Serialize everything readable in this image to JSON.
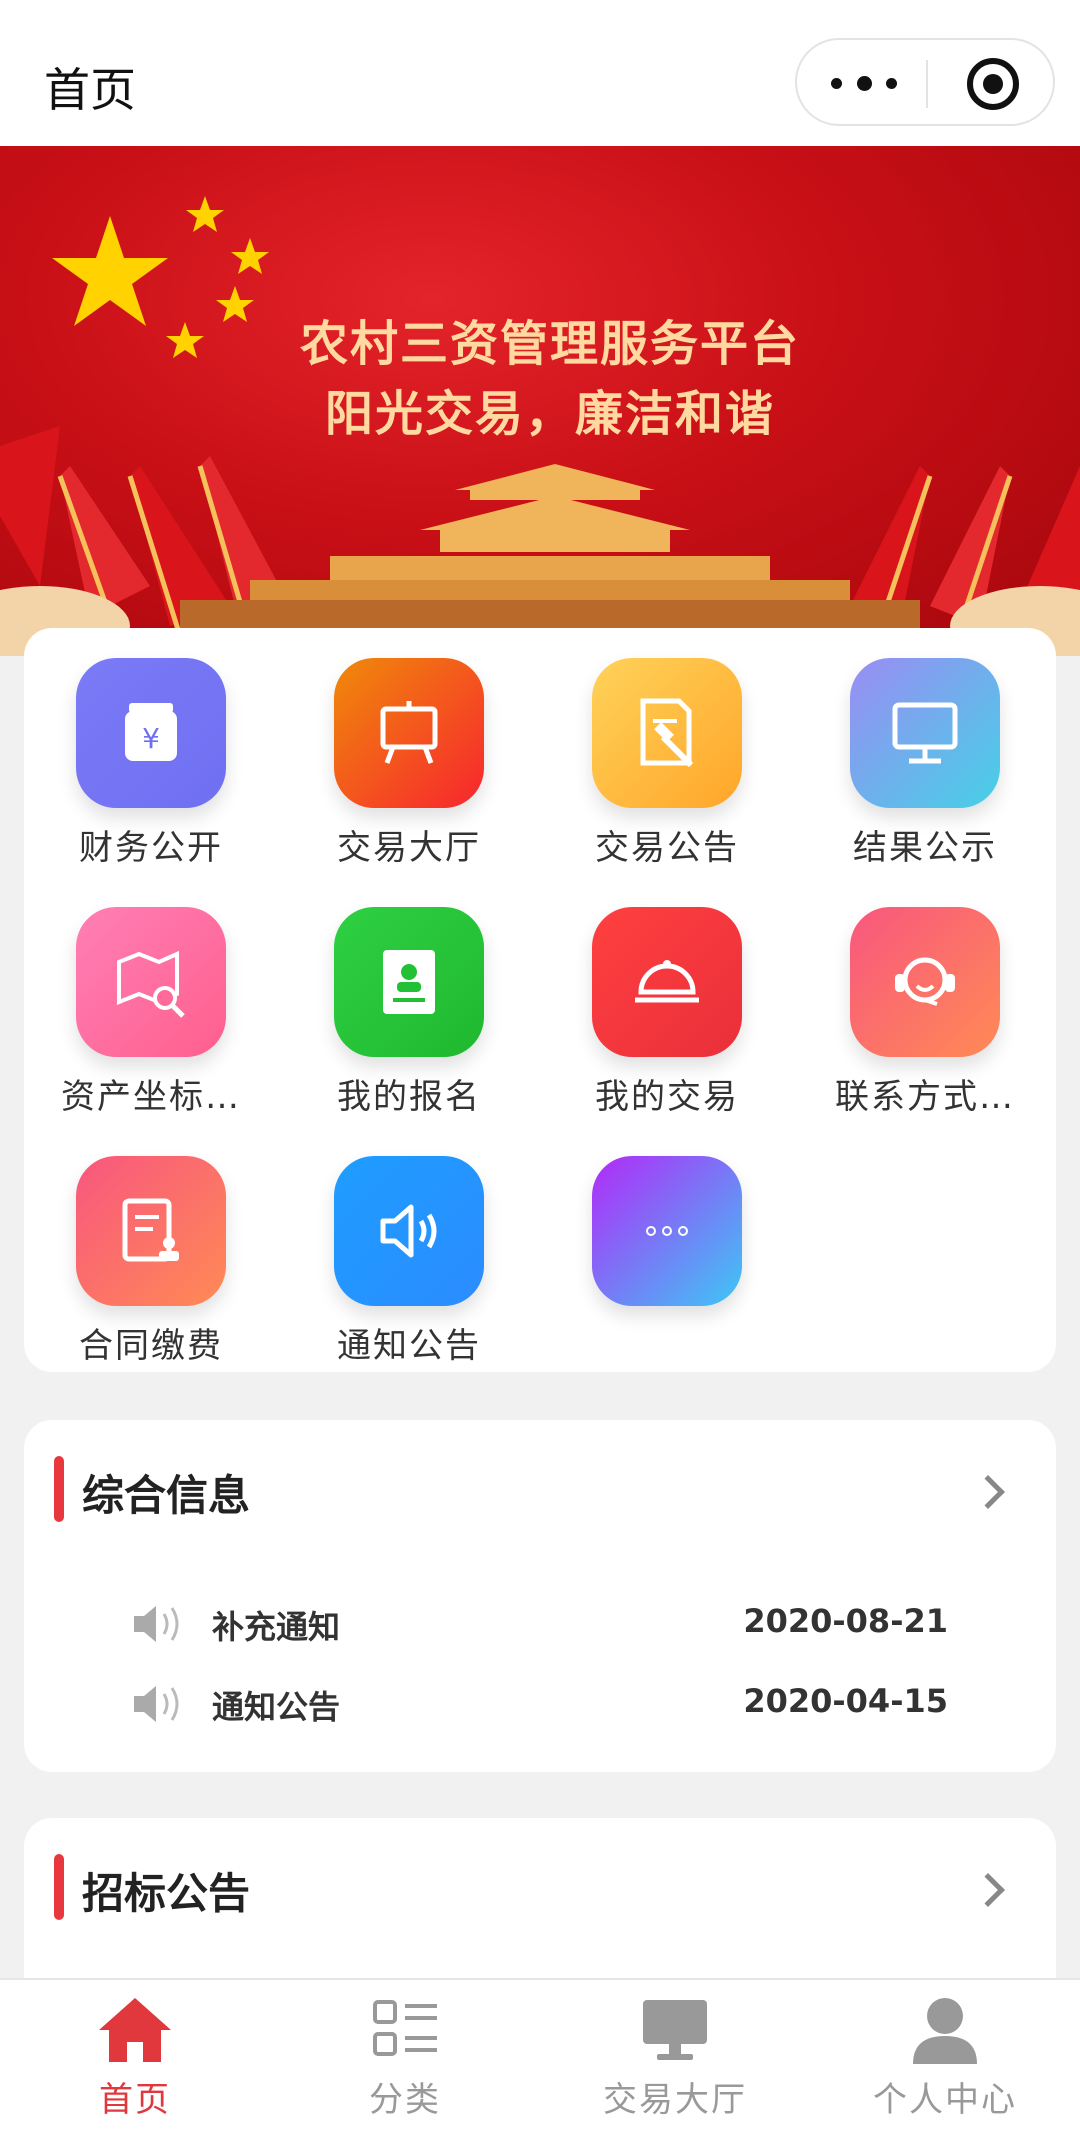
{
  "header": {
    "title": "首页"
  },
  "banner": {
    "line1": "农村三资管理服务平台",
    "line2": "阳光交易，廉洁和谐"
  },
  "grid": [
    {
      "label": "财务公开",
      "icon": "money-jar-icon",
      "colors": [
        "#7b7bf7",
        "#6f6ff2"
      ]
    },
    {
      "label": "交易大厅",
      "icon": "easel-icon",
      "colors": [
        "#f08a0a",
        "#f7252f"
      ]
    },
    {
      "label": "交易公告",
      "icon": "auction-document-icon",
      "colors": [
        "#ffd25a",
        "#ffa629"
      ]
    },
    {
      "label": "结果公示",
      "icon": "monitor-icon",
      "colors": [
        "#9a8cf3",
        "#46d1e6"
      ]
    },
    {
      "label": "资产坐标…",
      "icon": "map-search-icon",
      "colors": [
        "#ff7fb5",
        "#ff5f8e"
      ]
    },
    {
      "label": "我的报名",
      "icon": "id-card-icon",
      "colors": [
        "#2fd043",
        "#1fb82f"
      ]
    },
    {
      "label": "我的交易",
      "icon": "cloche-icon",
      "colors": [
        "#ff4040",
        "#e92f3a"
      ]
    },
    {
      "label": "联系方式…",
      "icon": "headset-icon",
      "colors": [
        "#f8577e",
        "#ff8a55"
      ]
    },
    {
      "label": "合同缴费",
      "icon": "contract-icon",
      "colors": [
        "#f8577e",
        "#ff8a55"
      ]
    },
    {
      "label": "通知公告",
      "icon": "speaker-icon",
      "colors": [
        "#1e9dff",
        "#2b8cff"
      ]
    },
    {
      "label": "",
      "icon": "more-dots-icon",
      "colors": [
        "#b22af7",
        "#3ec7f6"
      ]
    }
  ],
  "info": {
    "title": "综合信息",
    "items": [
      {
        "title": "补充通知",
        "date": "2020-08-21"
      },
      {
        "title": "通知公告",
        "date": "2020-04-15"
      }
    ]
  },
  "tender": {
    "title": "招标公告"
  },
  "nav": {
    "items": [
      {
        "label": "首页",
        "icon": "home-icon",
        "active": true
      },
      {
        "label": "分类",
        "icon": "category-list-icon",
        "active": false
      },
      {
        "label": "交易大厅",
        "icon": "monitor-icon",
        "active": false
      },
      {
        "label": "个人中心",
        "icon": "user-icon",
        "active": false
      }
    ]
  },
  "colors": {
    "accent": "#e0383d",
    "brand_red": "#c80f16",
    "banner_text": "#ffd9a0"
  }
}
